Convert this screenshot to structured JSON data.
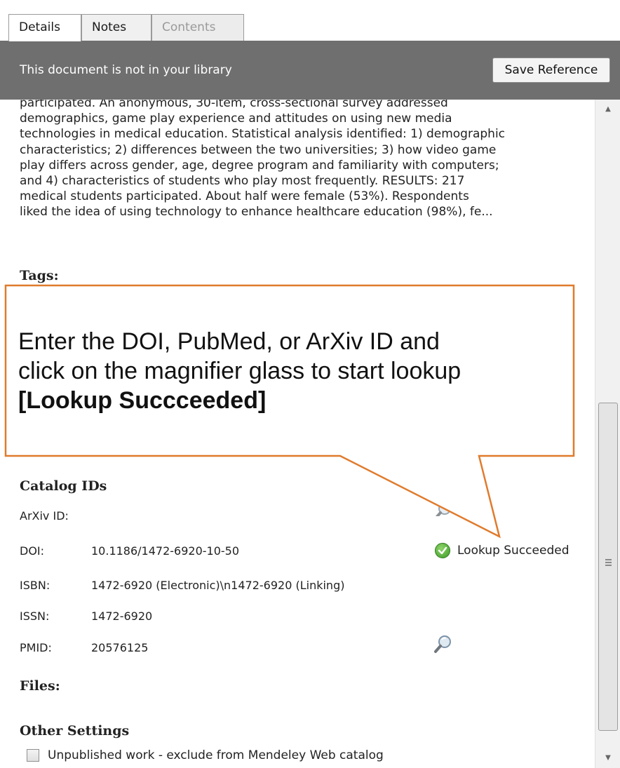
{
  "tabs": [
    {
      "label": "Details",
      "state": "active"
    },
    {
      "label": "Notes",
      "state": "normal"
    },
    {
      "label": "Contents",
      "state": "disabled"
    }
  ],
  "banner": {
    "text": "This document is not in your library",
    "button_label": "Save Reference"
  },
  "abstract_lines": [
    "participated. An anonymous, 30-item, cross-sectional survey addressed",
    "demographics, game play experience and attitudes on using new media",
    "technologies in medical education. Statistical analysis identified: 1) demographic",
    "characteristics; 2) differences between the two universities; 3) how video game",
    "play differs across gender, age, degree program and familiarity with computers;",
    "and 4) characteristics of students who play most frequently. RESULTS: 217",
    "medical students participated. About half were female (53%). Respondents",
    "liked the idea of using technology to enhance healthcare education (98%), fe..."
  ],
  "sections": {
    "tags": "Tags:",
    "catalog": "Catalog IDs",
    "files": "Files:",
    "other": "Other Settings"
  },
  "catalog_ids": [
    {
      "label": "ArXiv ID:",
      "value": ""
    },
    {
      "label": "DOI:",
      "value": "10.1186/1472-6920-10-50"
    },
    {
      "label": "ISBN:",
      "value": "1472-6920 (Electronic)\\n1472-6920 (Linking)"
    },
    {
      "label": "ISSN:",
      "value": "1472-6920"
    },
    {
      "label": "PMID:",
      "value": "20576125"
    }
  ],
  "lookup_status": "Lookup Succeeded",
  "checkbox": {
    "label": "Unpublished work - exclude from Mendeley Web catalog",
    "checked": false
  },
  "callout": {
    "line1": "Enter the DOI, PubMed, or ArXiv ID and",
    "line2": "click on the magnifier glass to start lookup",
    "bold": "[Lookup Succceeded]",
    "border_color": "#e07b2c"
  },
  "icons": {
    "search": "magnifier-icon",
    "success": "check-circle-icon"
  }
}
